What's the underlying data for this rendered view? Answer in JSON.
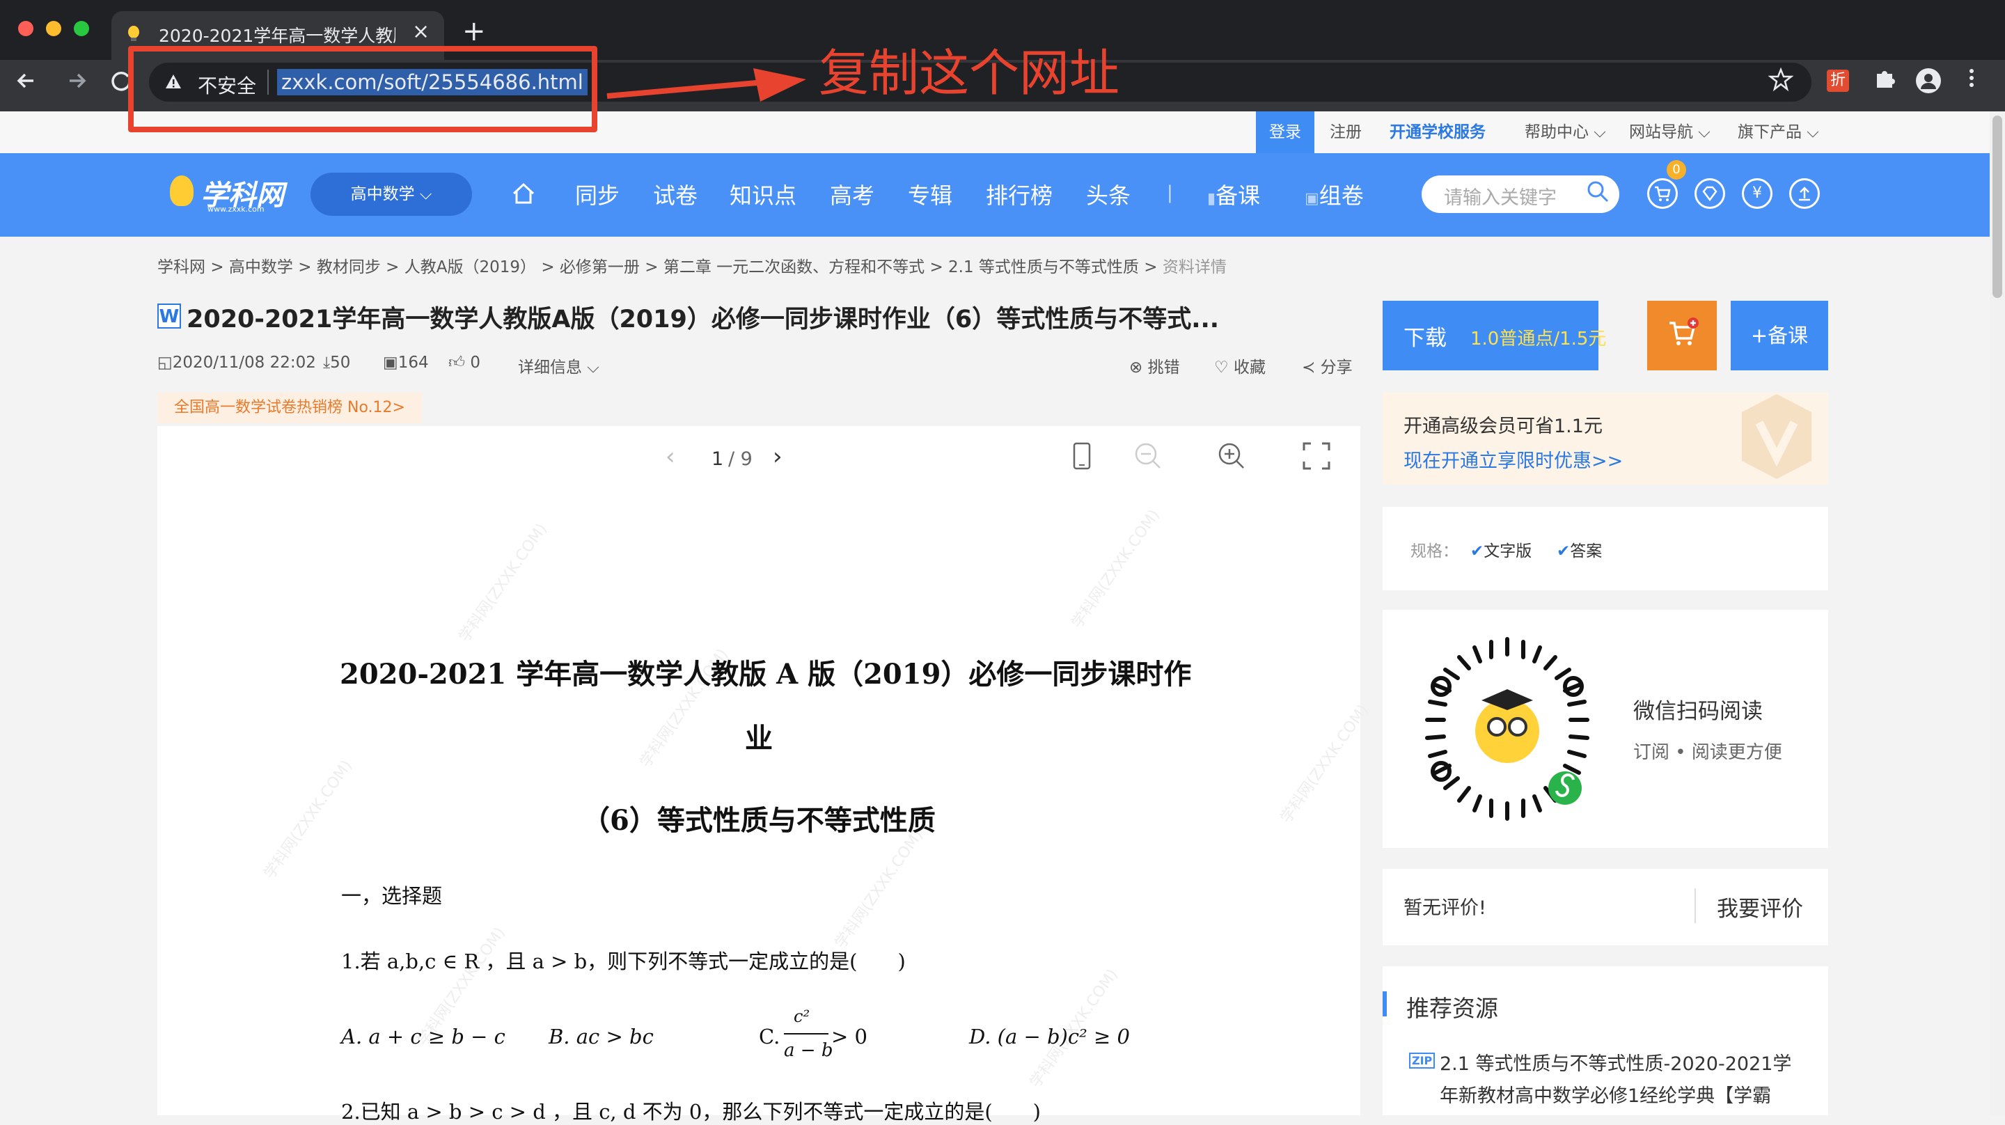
{
  "browser": {
    "tab_title": "2020-2021学年高一数学人教版",
    "tab_close": "×",
    "new_tab": "+",
    "security_label": "不安全",
    "url": "zxxk.com/soft/25554686.html",
    "extension_label": "折"
  },
  "annotation": {
    "note": "复制这个网址",
    "color": "#e8432f"
  },
  "topbar": {
    "login": "登录",
    "register": "注册",
    "open_service": "开通学校服务",
    "help": "帮助中心",
    "site_nav": "网站导航",
    "products": "旗下产品"
  },
  "header": {
    "logo": "学科网",
    "logo_sub": "www.zxxk.com",
    "subject": "高中数学",
    "nav": [
      "同步",
      "试卷",
      "知识点",
      "高考",
      "专辑",
      "排行榜",
      "头条"
    ],
    "nav_divider": "|",
    "prep": "备课",
    "compose": "组卷",
    "search_placeholder": "请输入关键字",
    "cart_count": "0",
    "accent": "#4a91f7"
  },
  "breadcrumb": {
    "items": [
      "学科网",
      "高中数学",
      "教材同步",
      "人教A版（2019）",
      "必修第一册",
      "第二章 一元二次函数、方程和不等式",
      "2.1 等式性质与不等式性质"
    ],
    "current": "资料详情",
    "separator": ">"
  },
  "doc": {
    "badge": "W",
    "title": "2020-2021学年高一数学人教版A版（2019）必修一同步课时作业（6）等式性质与不等式...",
    "date": "2020/11/08 22:02",
    "downloads": "50",
    "views": "164",
    "likes": "0",
    "details": "详细信息",
    "report": "挑错",
    "favorite": "收藏",
    "share": "分享",
    "hot_tag": "全国高一数学试卷热销榜 No.12>"
  },
  "viewer": {
    "page_current": "1",
    "page_total": "/ 9",
    "watermark": "学科网(ZXXK.COM)"
  },
  "page": {
    "heading_line1": "2020-2021 学年高一数学人教版 A 版（2019）必修一同步课时作",
    "heading_line2": "业",
    "heading_line3": "（6）等式性质与不等式性质",
    "section": "一，选择题",
    "q1": "1.若 a,b,c ∈ R ，且 a > b，则下列不等式一定成立的是(　　)",
    "q1_a": "A. a + c ≥ b − c",
    "q1_b": "B. ac > bc",
    "q1_c_prefix": "C.",
    "q1_c_num": "c²",
    "q1_c_den": "a − b",
    "q1_c_rel": "> 0",
    "q1_d": "D. (a − b)c² ≥ 0",
    "q2": "2.已知 a > b > c > d ，且 c, d 不为 0，那么下列不等式一定成立的是(　　)"
  },
  "sidebar": {
    "download": "下载",
    "price": "1.0普通点/1.5元",
    "prep_button": "+备课",
    "vip_line1": "开通高级会员可省1.1元",
    "vip_line2": "现在开通立享限时优惠>>",
    "spec_label": "规格：",
    "spec_text": "文字版",
    "spec_answer": "答案",
    "qr_title": "微信扫码阅读",
    "qr_sub": "订阅 • 阅读更方便",
    "review_none": "暂无评价!",
    "review_write": "我要评价",
    "rec_title": "推荐资源",
    "rec_zip": "ZIP",
    "rec_item": "2.1 等式性质与不等式性质-2020-2021学年新教材高中数学必修1经纶学典【学霸"
  }
}
